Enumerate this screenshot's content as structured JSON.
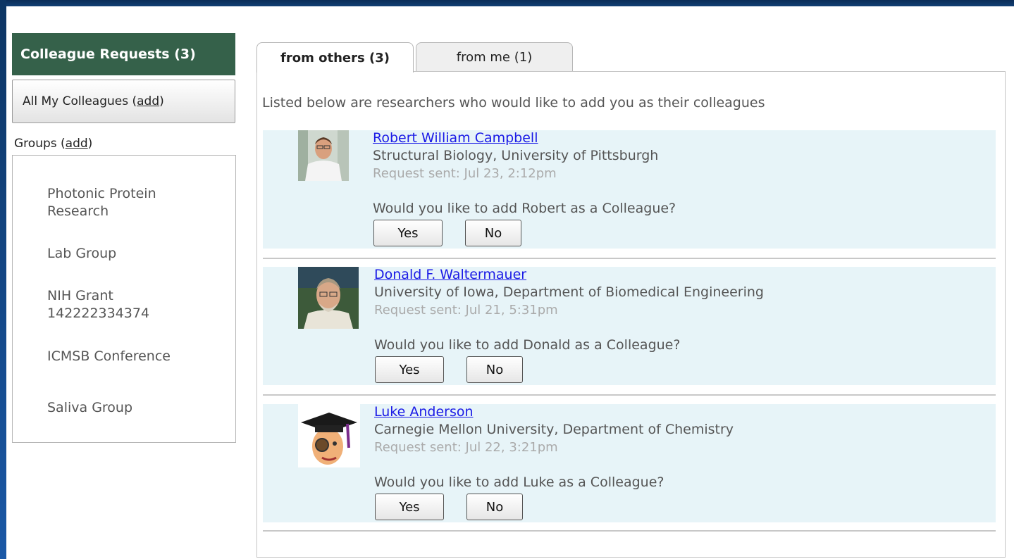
{
  "sidebar": {
    "header": "Colleague Requests (3)",
    "all_colleagues_label": "All My Colleagues",
    "add_label": "add",
    "groups_label": "Groups",
    "groups": [
      {
        "line1": "Photonic Protein",
        "line2": "Research"
      },
      {
        "line1": "Lab Group",
        "line2": ""
      },
      {
        "line1": "NIH Grant",
        "line2": "142222334374"
      },
      {
        "line1": "ICMSB Conference",
        "line2": ""
      },
      {
        "line1": "Saliva Group",
        "line2": ""
      }
    ]
  },
  "tabs": [
    {
      "label": "from others (3)",
      "active": true
    },
    {
      "label": "from me (1)",
      "active": false
    }
  ],
  "intro_text": "Listed below are researchers who would like to add you as their colleagues",
  "requests": [
    {
      "name": "Robert William Campbell",
      "affiliation": "Structural Biology, University of Pittsburgh",
      "sent": "Request sent: Jul 23, 2:12pm",
      "question": "Would you like to add Robert as a Colleague?",
      "yes": "Yes",
      "no": "No"
    },
    {
      "name": "Donald F. Waltermauer",
      "affiliation": "University of Iowa, Department of Biomedical Engineering",
      "sent": "Request sent: Jul 21, 5:31pm",
      "question": "Would you like to add Donald as a Colleague?",
      "yes": "Yes",
      "no": "No"
    },
    {
      "name": "Luke Anderson",
      "affiliation": "Carnegie Mellon University, Department of Chemistry",
      "sent": "Request sent: Jul 22, 3:21pm",
      "question": "Would you like to add Luke as a Colleague?",
      "yes": "Yes",
      "no": "No"
    }
  ],
  "colors": {
    "frame": "#12427a",
    "sidebar_header": "#35614a",
    "card_bg": "#e7f4f8",
    "link": "#1a1ae6"
  }
}
